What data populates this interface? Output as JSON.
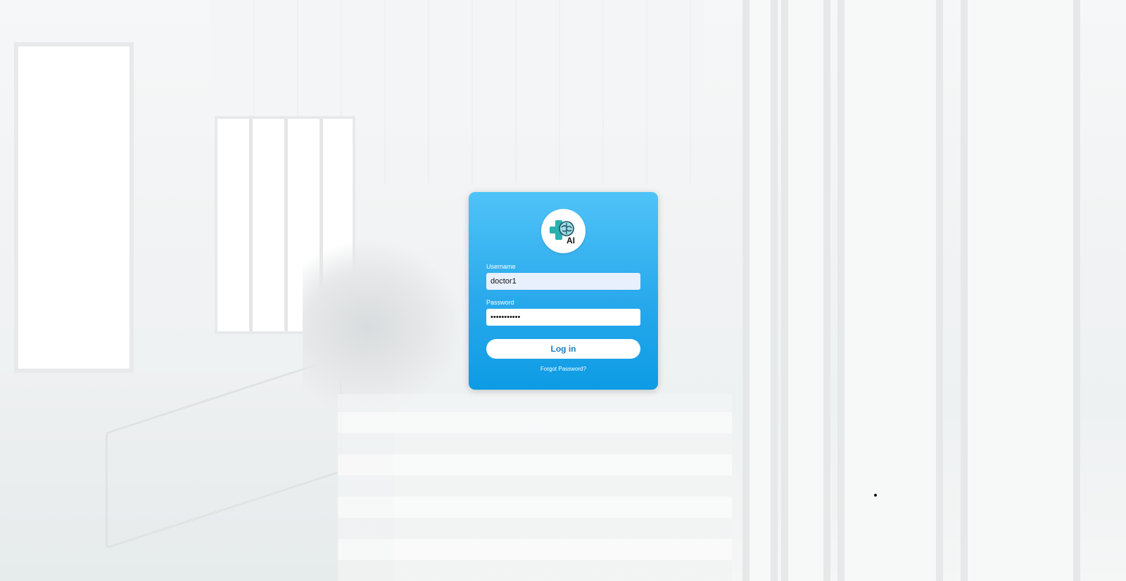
{
  "login": {
    "logo_text": "AI",
    "username_label": "Username",
    "username_value": "doctor1",
    "password_label": "Password",
    "password_value": "•••••••••••",
    "login_button": "Log in",
    "forgot_password": "Forgot Password?"
  },
  "colors": {
    "card_top": "#4fc3f7",
    "card_bottom": "#0d9be3",
    "button_text": "#1b7fc4",
    "logo_cross": "#29a9a9"
  },
  "icons": {
    "logo": "medical-cross-brain-icon"
  }
}
